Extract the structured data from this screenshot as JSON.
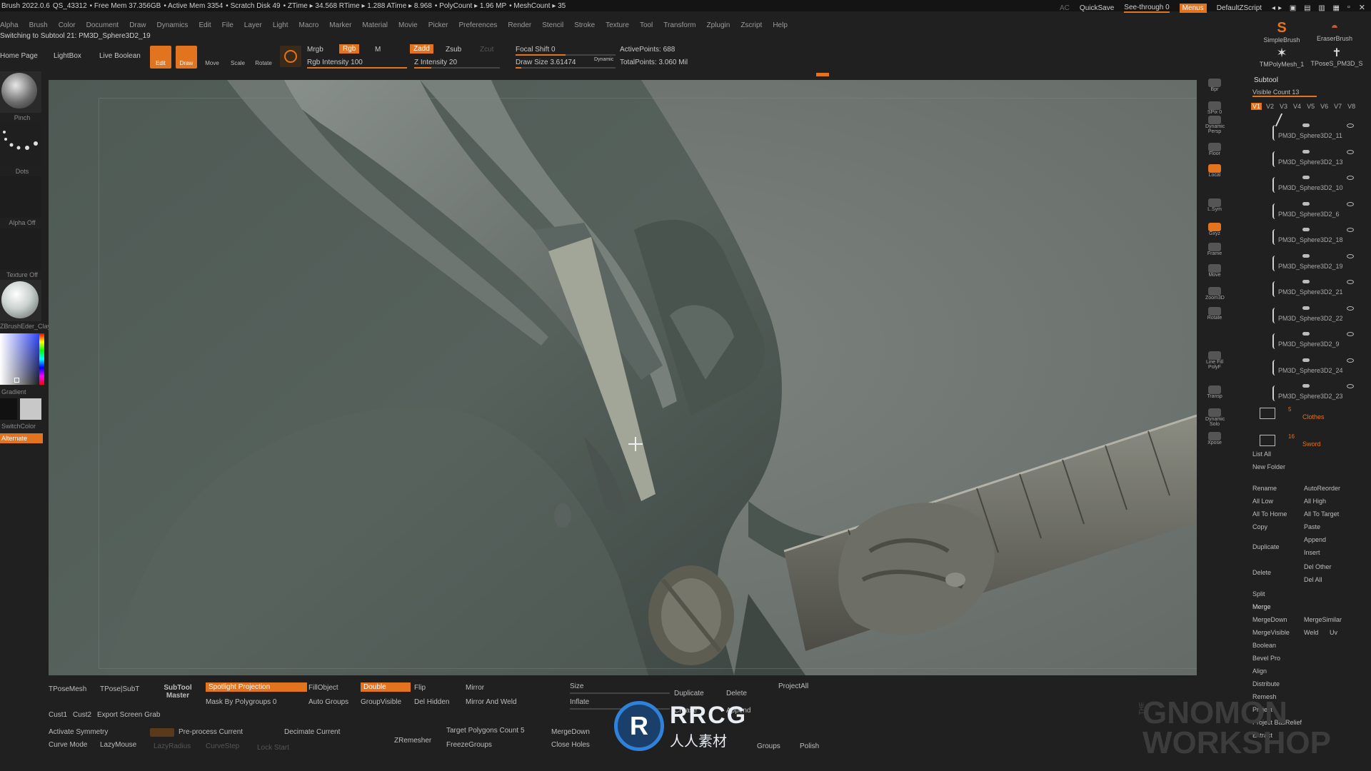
{
  "status": {
    "app": "Brush 2022.0.6",
    "qs": "QS_43312",
    "free_mem": "• Free Mem 37.356GB",
    "active_mem": "• Active Mem 3354",
    "scratch": "• Scratch Disk 49",
    "ztime": "• ZTime ▸ 34.568 RTime ▸ 1.288 ATime ▸ 8.968",
    "polycount": "• PolyCount ▸ 1.96 MP",
    "meshcount": "• MeshCount ▸ 35"
  },
  "top_right": {
    "ac": "AC",
    "quicksave": "QuickSave",
    "seethrough": "See-through  0",
    "menus": "Menus",
    "script": "DefaultZScript"
  },
  "menu": [
    "Alpha",
    "Brush",
    "Color",
    "Document",
    "Draw",
    "Dynamics",
    "Edit",
    "File",
    "Layer",
    "Light",
    "Macro",
    "Marker",
    "Material",
    "Movie",
    "Picker",
    "Preferences",
    "Render",
    "Stencil",
    "Stroke",
    "Texture",
    "Tool",
    "Transform",
    "Zplugin",
    "Zscript",
    "Help"
  ],
  "notice": "Switching to Subtool 21:  PM3D_Sphere3D2_19",
  "toolbar": {
    "home": "Home Page",
    "lightbox": "LightBox",
    "live_boolean": "Live Boolean",
    "edit": "Edit",
    "draw": "Draw",
    "move": "Move",
    "scale": "Scale",
    "rotate": "Rotate",
    "mrgb": "Mrgb",
    "rgb": "Rgb",
    "m": "M",
    "rgb_intensity": "Rgb Intensity 100",
    "zadd": "Zadd",
    "zsub": "Zsub",
    "zcut": "Zcut",
    "z_intensity": "Z Intensity 20",
    "focal_shift": "Focal Shift 0",
    "draw_size": "Draw Size 3.61474",
    "dynamic": "Dynamic",
    "active_points": "ActivePoints: 688",
    "total_points": "TotalPoints: 3.060 Mil",
    "z_intensity_level": 20,
    "rgb_intensity_level": 100
  },
  "left": {
    "brush": "Pinch",
    "stroke": "Dots",
    "alpha": "Alpha Off",
    "texture": "Texture Off",
    "material": "ZBrushEder_ClayM",
    "gradient": "Gradient",
    "switch": "SwitchColor",
    "alternate": "Alternate"
  },
  "right_icons": [
    "Bpr",
    "SPix 0",
    "Dynamic Persp",
    "Floor",
    "Local",
    "L.Sym",
    "Gxyz",
    "Frame",
    "Move",
    "Zoom3D",
    "Rotate",
    "Line Fill PolyF",
    "Transp",
    "Dynamic Solo",
    "Xpose"
  ],
  "subtool": {
    "title": "Subtool",
    "visible_count": "Visible Count 13",
    "versions": [
      "V1",
      "V2",
      "V3",
      "V4",
      "V5",
      "V6",
      "V7",
      "V8"
    ],
    "items": [
      "PM3D_Sphere3D2_11",
      "PM3D_Sphere3D2_13",
      "PM3D_Sphere3D2_10",
      "PM3D_Sphere3D2_6",
      "PM3D_Sphere3D2_18",
      "PM3D_Sphere3D2_19",
      "PM3D_Sphere3D2_21",
      "PM3D_Sphere3D2_22",
      "PM3D_Sphere3D2_9",
      "PM3D_Sphere3D2_24",
      "PM3D_Sphere3D2_23"
    ],
    "folders": [
      {
        "count": "5",
        "name": "Clothes"
      },
      {
        "count": "16",
        "name": "Sword"
      }
    ],
    "buttons": {
      "list_all": "List All",
      "new_folder": "New Folder",
      "rename": "Rename",
      "autoreorder": "AutoReorder",
      "all_low": "All Low",
      "all_high": "All High",
      "all_to_home": "All To Home",
      "all_to_target": "All To Target",
      "copy": "Copy",
      "paste": "Paste",
      "append": "Append",
      "duplicate": "Duplicate",
      "insert": "Insert",
      "delete": "Delete",
      "del_other": "Del Other",
      "del_all": "Del All",
      "split": "Split",
      "merge": "Merge",
      "mergedown": "MergeDown",
      "mergesimilar": "MergeSimilar",
      "mergevisible": "MergeVisible",
      "weld": "Weld",
      "uv": "Uv",
      "boolean": "Boolean",
      "bevel_pro": "Bevel Pro",
      "align": "Align",
      "distribute": "Distribute",
      "remesh": "Remesh",
      "project": "Project",
      "project_basrelief": "Project BasRelief",
      "extract": "Extract"
    }
  },
  "brushes": {
    "simple": "SimpleBrush",
    "eraser": "EraserBrush",
    "tpolymesh": "TMPolyMesh_1",
    "tposes": "TPoseS_PM3D_S"
  },
  "bottom": {
    "tposemesh": "TPoseMesh",
    "tpose_subt": "TPose|SubT",
    "subtool_master": "SubTool Master",
    "spotlight": "Spotlight Projection",
    "mask_polygroups": "Mask By Polygroups 0",
    "fillobject": "FillObject",
    "double": "Double",
    "flip": "Flip",
    "auto_groups": "Auto Groups",
    "groupvisible": "GroupVisible",
    "del_hidden": "Del Hidden",
    "mirror": "Mirror",
    "mirror_weld": "Mirror And Weld",
    "size": "Size",
    "inflate": "Inflate",
    "duplicate": "Duplicate",
    "delete": "Delete",
    "projectall": "ProjectAll",
    "crease": "Crease",
    "append": "Append",
    "cust1": "Cust1",
    "cust2": "Cust2",
    "export": "Export Screen Grab",
    "activate_symmetry": "Activate Symmetry",
    "curve_mode": "Curve Mode",
    "lazymouse": "LazyMouse",
    "lazyradius": "LazyRadius",
    "curvestep": "CurveStep",
    "lockstart": "Lock Start",
    "preprocess": "Pre-process Current",
    "decimate": "Decimate Current",
    "zremesher": "ZRemesher",
    "target_poly": "Target Polygons Count 5",
    "freezegroups": "FreezeGroups",
    "mergedown": "MergeDown",
    "closeholes": "Close Holes",
    "groups": "Groups",
    "polish": "Polish"
  },
  "watermark": {
    "rrcg": "RRCG",
    "sub": "人人素材",
    "gnomon1": "THE",
    "gnomon2": "GNOMON",
    "gnomon3": "WORKSHOP"
  }
}
